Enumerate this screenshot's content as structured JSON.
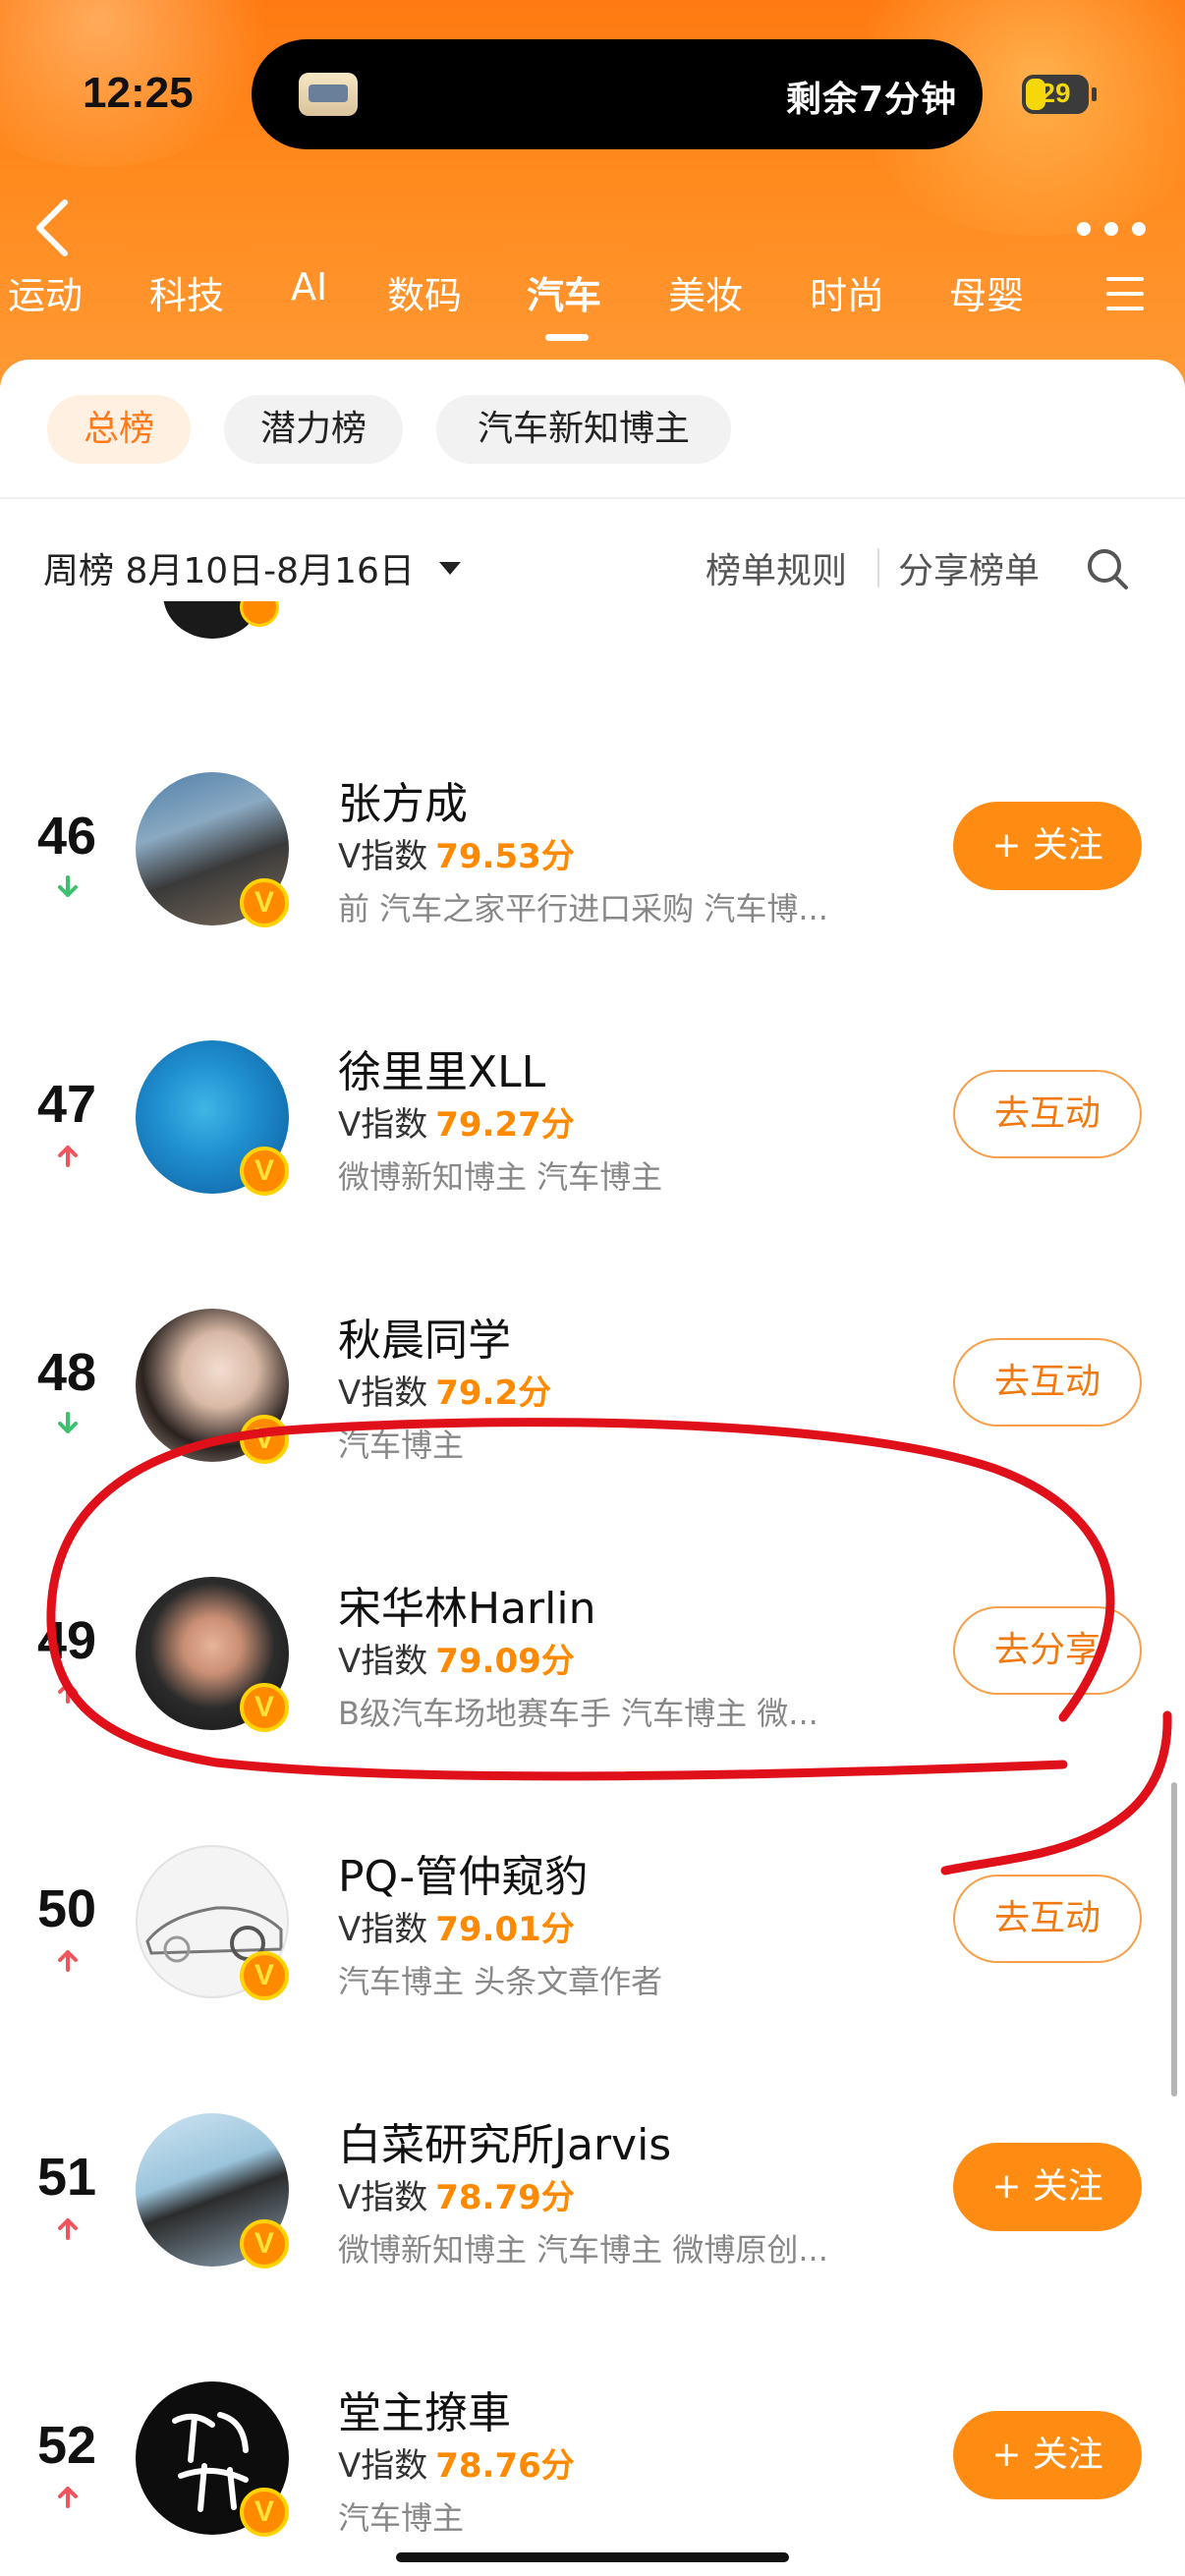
{
  "status_bar": {
    "time": "12:25",
    "island_text": "剩余7分钟",
    "battery": "29"
  },
  "category_tabs": [
    "运动",
    "科技",
    "AI",
    "数码",
    "汽车",
    "美妆",
    "时尚",
    "母婴"
  ],
  "active_category": "汽车",
  "sub_tabs": [
    "总榜",
    "潜力榜",
    "汽车新知博主"
  ],
  "active_sub_tab": "总榜",
  "week": {
    "label": "周榜 8月10日-8月16日"
  },
  "links": {
    "rules": "榜单规则",
    "share": "分享榜单"
  },
  "list": {
    "v_label": "V指数",
    "items": [
      {
        "rank": "46",
        "trend": "down",
        "name": "张方成",
        "score": "79.53分",
        "desc": "前 汽车之家平行进口采购 汽车博...",
        "button": "+ 关注",
        "button_style": "follow"
      },
      {
        "rank": "47",
        "trend": "up",
        "name": "徐里里XLL",
        "score": "79.27分",
        "desc": "微博新知博主 汽车博主",
        "button": "去互动",
        "button_style": "outline"
      },
      {
        "rank": "48",
        "trend": "down",
        "name": "秋晨同学",
        "score": "79.2分",
        "desc": "汽车博主",
        "button": "去互动",
        "button_style": "outline"
      },
      {
        "rank": "49",
        "trend": "up",
        "name": "宋华林Harlin",
        "score": "79.09分",
        "desc": "B级汽车场地赛车手 汽车博主 微...",
        "button": "去分享",
        "button_style": "outline"
      },
      {
        "rank": "50",
        "trend": "up",
        "name": "PQ-管仲窥豹",
        "score": "79.01分",
        "desc": "汽车博主 头条文章作者",
        "button": "去互动",
        "button_style": "outline"
      },
      {
        "rank": "51",
        "trend": "up",
        "name": "白菜研究所Jarvis",
        "score": "78.79分",
        "desc": "微博新知博主 汽车博主 微博原创...",
        "button": "+ 关注",
        "button_style": "follow"
      },
      {
        "rank": "52",
        "trend": "up",
        "name": "堂主撩車",
        "score": "78.76分",
        "desc": "汽车博主",
        "button": "+ 关注",
        "button_style": "follow"
      }
    ]
  },
  "colors": {
    "header_orange": "#ff7a12",
    "score_orange": "#ff8a00",
    "trend_up": "#f2545b",
    "trend_down": "#3cc26e",
    "annotation_red": "#e0101a"
  }
}
